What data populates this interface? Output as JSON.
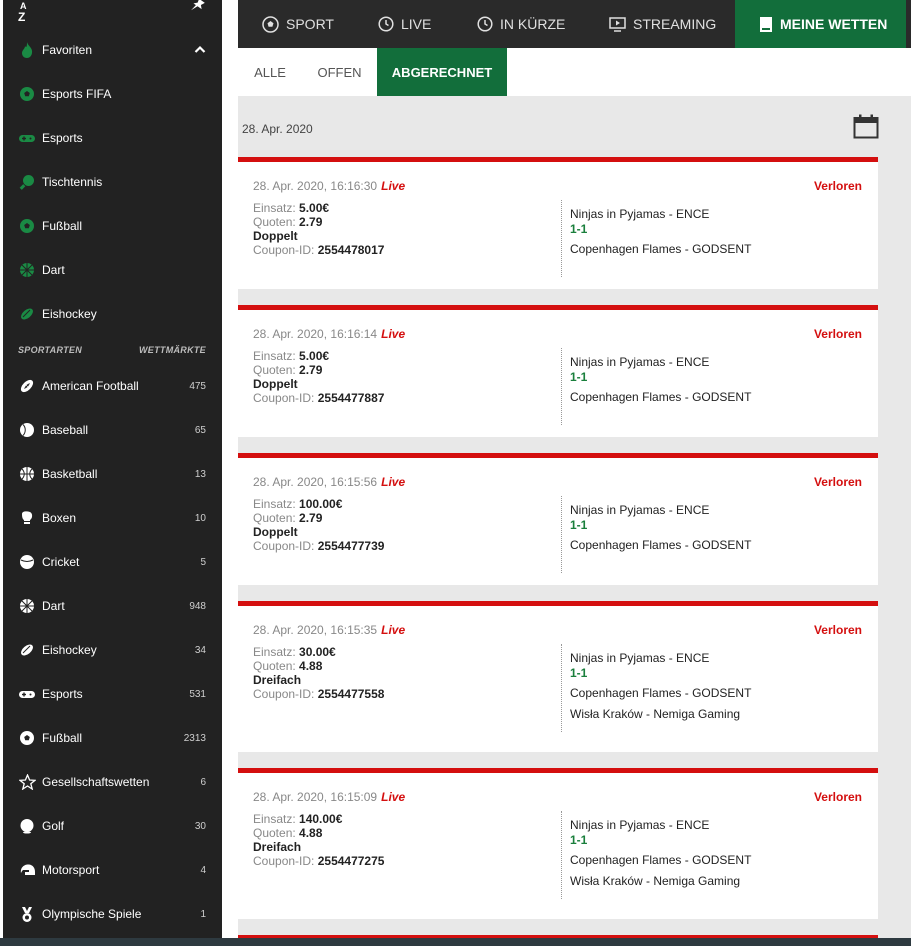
{
  "sidebar": {
    "az_top": "A",
    "az_bottom": "Z",
    "favorites_label": "Favoriten",
    "favorites": [
      {
        "label": "Esports FIFA",
        "icon": "soccer-ball-icon"
      },
      {
        "label": "Esports",
        "icon": "gamepad-icon"
      },
      {
        "label": "Tischtennis",
        "icon": "table-tennis-icon"
      },
      {
        "label": "Fußball",
        "icon": "soccer-ball-icon"
      },
      {
        "label": "Dart",
        "icon": "dart-icon"
      },
      {
        "label": "Eishockey",
        "icon": "ice-hockey-icon"
      }
    ],
    "section_left": "SPORTARTEN",
    "section_right": "WETTMÄRKTE",
    "sports": [
      {
        "label": "American Football",
        "count": "475",
        "icon": "american-football-icon"
      },
      {
        "label": "Baseball",
        "count": "65",
        "icon": "baseball-icon"
      },
      {
        "label": "Basketball",
        "count": "13",
        "icon": "basketball-icon"
      },
      {
        "label": "Boxen",
        "count": "10",
        "icon": "boxing-glove-icon"
      },
      {
        "label": "Cricket",
        "count": "5",
        "icon": "cricket-ball-icon"
      },
      {
        "label": "Dart",
        "count": "948",
        "icon": "dart-icon"
      },
      {
        "label": "Eishockey",
        "count": "34",
        "icon": "ice-hockey-icon"
      },
      {
        "label": "Esports",
        "count": "531",
        "icon": "gamepad-icon"
      },
      {
        "label": "Fußball",
        "count": "2313",
        "icon": "soccer-ball-icon"
      },
      {
        "label": "Gesellschaftswetten",
        "count": "6",
        "icon": "star-icon"
      },
      {
        "label": "Golf",
        "count": "30",
        "icon": "golf-ball-icon"
      },
      {
        "label": "Motorsport",
        "count": "4",
        "icon": "helmet-icon"
      },
      {
        "label": "Olympische Spiele",
        "count": "1",
        "icon": "medal-icon"
      }
    ]
  },
  "topnav": {
    "sport": "SPORT",
    "live": "LIVE",
    "soon": "IN KÜRZE",
    "streaming": "STREAMING",
    "mybets": "MEINE WETTEN"
  },
  "subnav": {
    "all": "ALLE",
    "open": "OFFEN",
    "settled": "ABGERECHNET"
  },
  "date_header": "28. Apr. 2020",
  "colors": {
    "accent_green": "#126e3b",
    "lost_red": "#d40f0f",
    "score_green": "#1a7f3c",
    "sidebar_bg": "#222222"
  },
  "labels": {
    "stake": "Einsatz:",
    "odds": "Quoten:",
    "coupon": "Coupon-ID:",
    "live": "Live"
  },
  "bets": [
    {
      "datetime": "28. Apr. 2020, 16:16:30",
      "status": "Verloren",
      "stake": "5.00€",
      "odds": "2.79",
      "type": "Doppelt",
      "coupon": "2554478017",
      "events": [
        {
          "name": "Ninjas in Pyjamas - ENCE",
          "score": "1-1"
        },
        {
          "name": "Copenhagen Flames - GODSENT",
          "score": ""
        }
      ]
    },
    {
      "datetime": "28. Apr. 2020, 16:16:14",
      "status": "Verloren",
      "stake": "5.00€",
      "odds": "2.79",
      "type": "Doppelt",
      "coupon": "2554477887",
      "events": [
        {
          "name": "Ninjas in Pyjamas - ENCE",
          "score": "1-1"
        },
        {
          "name": "Copenhagen Flames - GODSENT",
          "score": ""
        }
      ]
    },
    {
      "datetime": "28. Apr. 2020, 16:15:56",
      "status": "Verloren",
      "stake": "100.00€",
      "odds": "2.79",
      "type": "Doppelt",
      "coupon": "2554477739",
      "events": [
        {
          "name": "Ninjas in Pyjamas - ENCE",
          "score": "1-1"
        },
        {
          "name": "Copenhagen Flames - GODSENT",
          "score": ""
        }
      ]
    },
    {
      "datetime": "28. Apr. 2020, 16:15:35",
      "status": "Verloren",
      "stake": "30.00€",
      "odds": "4.88",
      "type": "Dreifach",
      "coupon": "2554477558",
      "events": [
        {
          "name": "Ninjas in Pyjamas - ENCE",
          "score": "1-1"
        },
        {
          "name": "Copenhagen Flames - GODSENT",
          "score": ""
        },
        {
          "name": "Wisła Kraków - Nemiga Gaming",
          "score": ""
        }
      ]
    },
    {
      "datetime": "28. Apr. 2020, 16:15:09",
      "status": "Verloren",
      "stake": "140.00€",
      "odds": "4.88",
      "type": "Dreifach",
      "coupon": "2554477275",
      "events": [
        {
          "name": "Ninjas in Pyjamas - ENCE",
          "score": "1-1"
        },
        {
          "name": "Copenhagen Flames - GODSENT",
          "score": ""
        },
        {
          "name": "Wisła Kraków - Nemiga Gaming",
          "score": ""
        }
      ]
    }
  ]
}
